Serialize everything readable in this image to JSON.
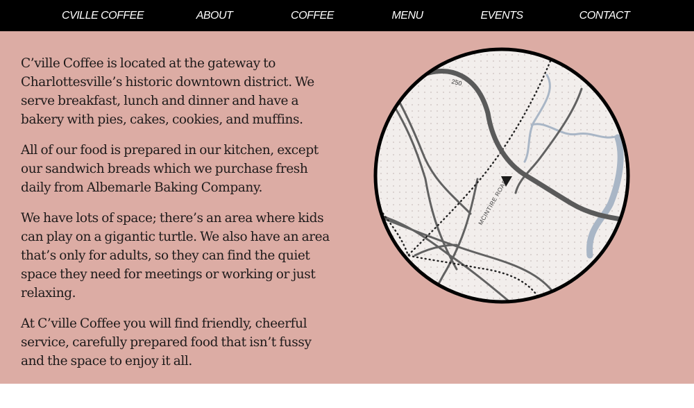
{
  "nav": {
    "items": [
      {
        "label": "CVILLE COFFEE"
      },
      {
        "label": "ABOUT"
      },
      {
        "label": "COFFEE"
      },
      {
        "label": "MENU"
      },
      {
        "label": "EVENTS"
      },
      {
        "label": "CONTACT"
      }
    ]
  },
  "content": {
    "paragraphs": [
      "C’ville Coffee is located at the gateway to Charlottesville’s historic downtown district. We serve breakfast, lunch and dinner and have a bakery with pies, cakes, cookies, and muffins.",
      "All of our food is prepared in our kitchen, except our sandwich breads which we purchase fresh daily from Albemarle Baking Company.",
      "We have lots of space; there’s an area where kids can play on a gigantic turtle. We also have an area that’s only for adults, so they can find the quiet space they need for meetings or working or just relaxing.",
      "At C’ville Coffee you will find friendly, cheerful service, carefully prepared food that isn’t fussy and the space to enjoy it all."
    ]
  },
  "map": {
    "route_label": "250",
    "road_label": "MCINTIRE ROAD",
    "marker_icon": "location-marker-icon"
  },
  "colors": {
    "nav_bg": "#000000",
    "nav_text": "#ffffff",
    "page_bg": "#dcaca4",
    "text": "#1e1a1a",
    "map_bg": "#f2eeec",
    "road": "#616161",
    "highway": "#5a5a5a",
    "water": "#a9b6c6"
  }
}
